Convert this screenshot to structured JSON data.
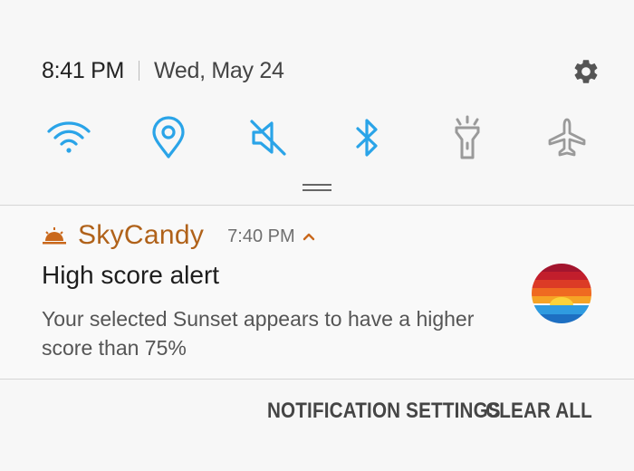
{
  "status": {
    "time": "8:41 PM",
    "date": "Wed, May 24"
  },
  "quick_toggles": [
    {
      "name": "wifi",
      "icon": "wifi-icon",
      "state": "on"
    },
    {
      "name": "location",
      "icon": "location-pin-icon",
      "state": "on"
    },
    {
      "name": "sound",
      "icon": "mute-icon",
      "state": "on"
    },
    {
      "name": "bluetooth",
      "icon": "bluetooth-icon",
      "state": "on"
    },
    {
      "name": "flashlight",
      "icon": "flashlight-icon",
      "state": "off"
    },
    {
      "name": "airplane",
      "icon": "airplane-icon",
      "state": "off"
    }
  ],
  "notification": {
    "app_name": "SkyCandy",
    "time": "7:40 PM",
    "title": "High score alert",
    "body": "Your selected Sunset appears to have a higher score than 75%"
  },
  "actions": {
    "notification_settings": "NOTIFICATION SETTINGS",
    "clear_all": "CLEAR ALL"
  },
  "colors": {
    "toggle_on": "#2aa4e8",
    "toggle_off": "#9a9a9a",
    "app_accent": "#b0621a",
    "background": "#f7f7f7"
  }
}
